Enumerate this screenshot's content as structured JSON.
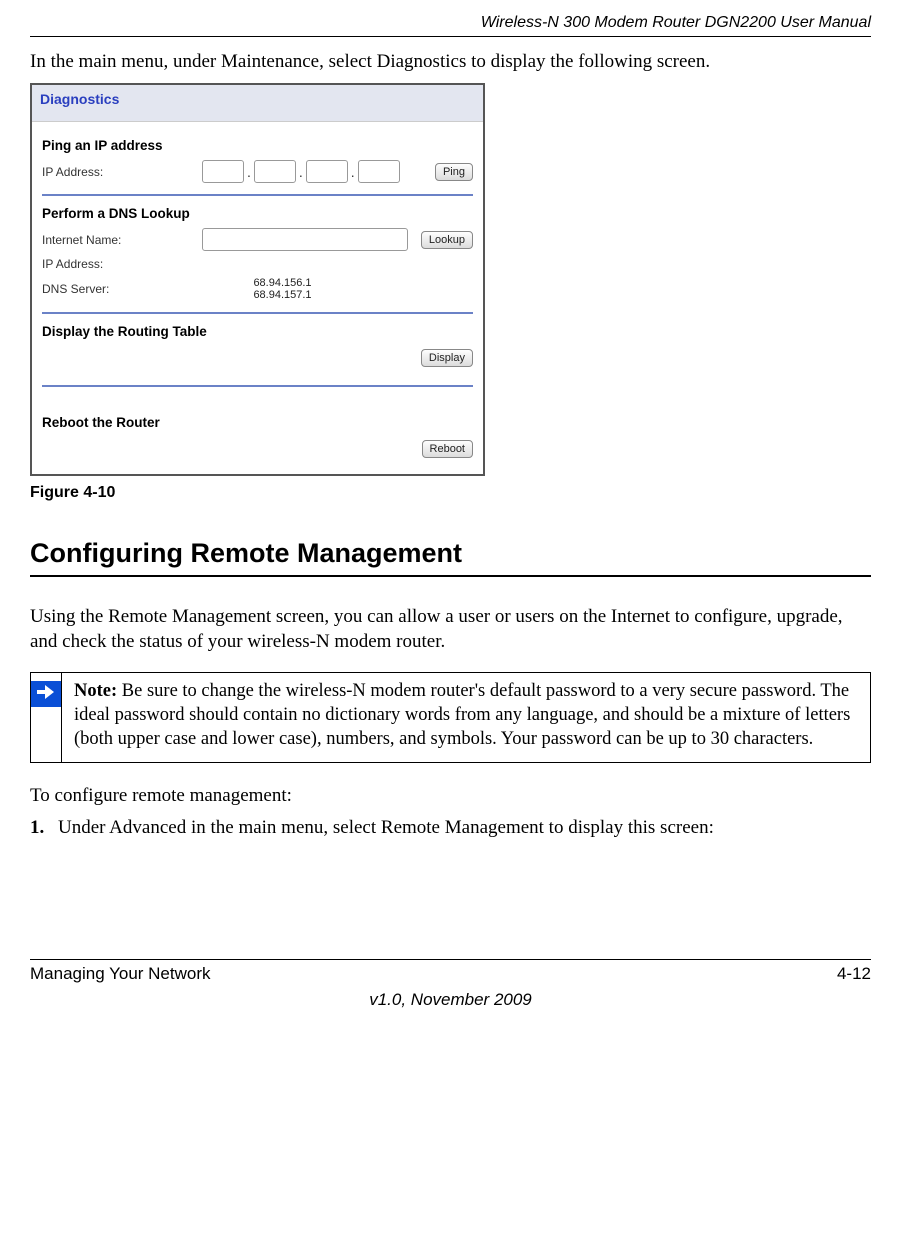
{
  "header": {
    "title": "Wireless-N 300 Modem Router DGN2200 User Manual"
  },
  "intro": "In the main menu, under Maintenance, select Diagnostics to display the following screen.",
  "screenshot": {
    "panel_title": "Diagnostics",
    "ping": {
      "section": "Ping an IP address",
      "label": "IP Address:",
      "button": "Ping"
    },
    "dns": {
      "section": "Perform a DNS Lookup",
      "name_label": "Internet Name:",
      "button": "Lookup",
      "ip_label": "IP Address:",
      "server_label": "DNS Server:",
      "server_values": "68.94.156.1\n68.94.157.1"
    },
    "routing": {
      "section": "Display the Routing Table",
      "button": "Display"
    },
    "reboot": {
      "section": "Reboot the Router",
      "button": "Reboot"
    }
  },
  "figure_caption": "Figure 4-10",
  "heading": "Configuring Remote Management",
  "para1": "Using the Remote Management screen, you can allow a user or users on the Internet to configure, upgrade, and check the status of your wireless-N modem router.",
  "note": {
    "label": "Note:",
    "text": " Be sure to change the wireless-N modem router's default password to a very secure password. The ideal password should contain no dictionary words from any language, and should be a mixture of letters (both upper case and lower case), numbers, and symbols. Your password can be up to 30 characters."
  },
  "config_intro": "To configure remote management:",
  "step1": {
    "num": "1.",
    "text": "Under Advanced in the main menu, select Remote Management to display this screen:"
  },
  "footer": {
    "left": "Managing Your Network",
    "right": "4-12",
    "center": "v1.0, November 2009"
  }
}
